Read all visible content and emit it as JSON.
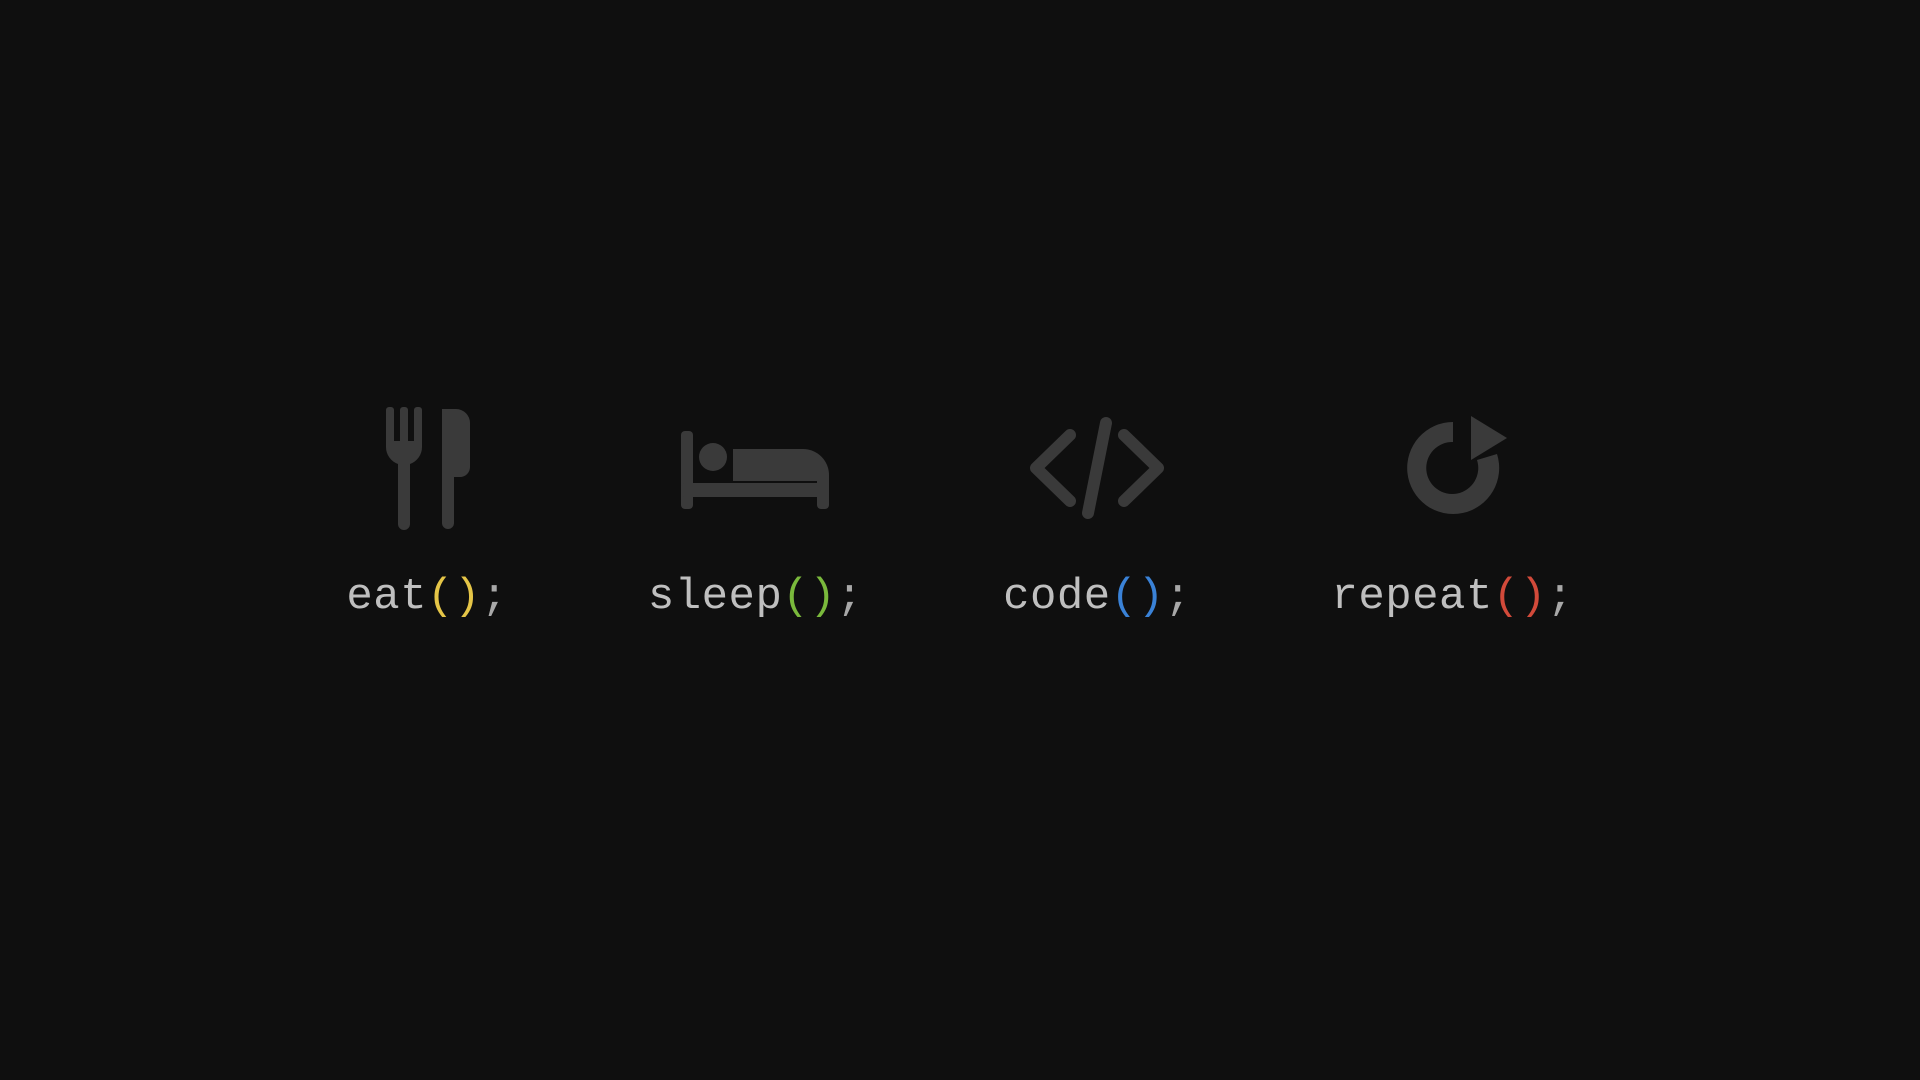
{
  "items": [
    {
      "fn": "eat",
      "parens": "()",
      "semi": ";",
      "paren_color": "#e5c547",
      "icon": "fork-knife-icon"
    },
    {
      "fn": "sleep",
      "parens": "()",
      "semi": ";",
      "paren_color": "#7ab93c",
      "icon": "bed-icon"
    },
    {
      "fn": "code",
      "parens": "()",
      "semi": ";",
      "paren_color": "#3a82d7",
      "icon": "code-brackets-icon"
    },
    {
      "fn": "repeat",
      "parens": "()",
      "semi": ";",
      "paren_color": "#d24a3a",
      "icon": "redo-icon"
    }
  ],
  "icon_color": "#3a3a3a",
  "text_color": "#bfbfbf"
}
